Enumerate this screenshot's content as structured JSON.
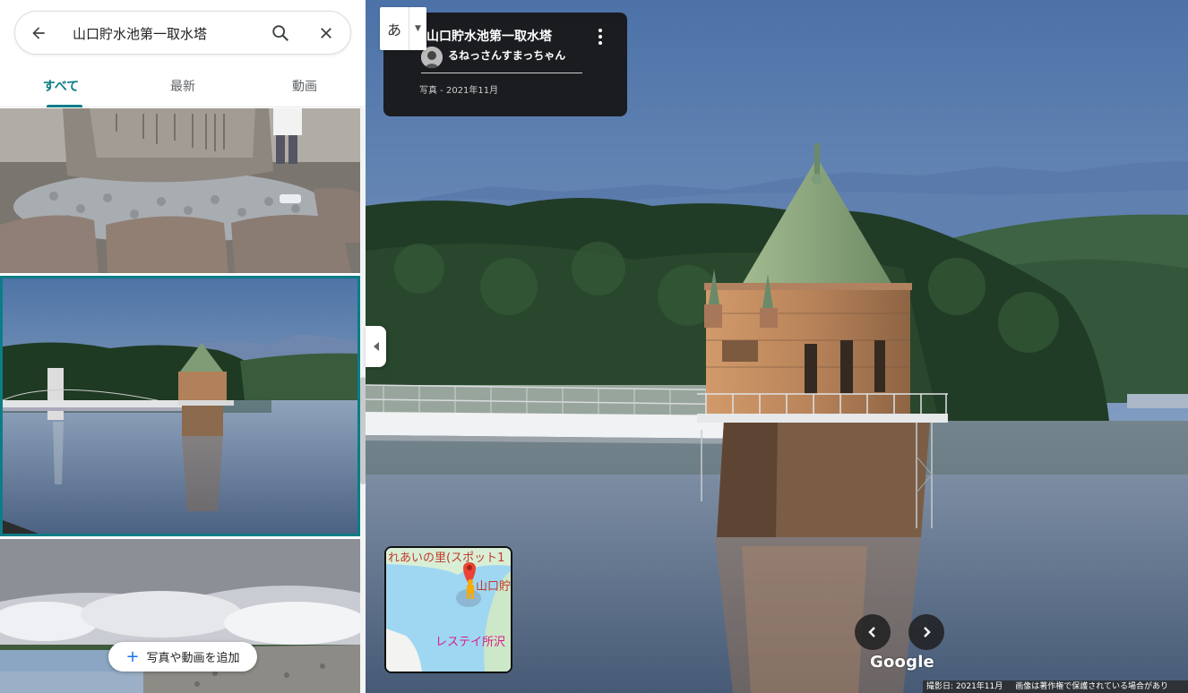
{
  "search": {
    "query": "山口貯水池第一取水塔"
  },
  "tabs": [
    {
      "label": "すべて"
    },
    {
      "label": "最新"
    },
    {
      "label": "動画"
    }
  ],
  "add_button": {
    "label": "写真や動画を追加"
  },
  "photo_info": {
    "title": "山口貯水池第一取水塔",
    "author": "るねっさんすまっちゃん",
    "meta": "写真 - 2021年11月"
  },
  "ime": {
    "char": "あ"
  },
  "minimap": {
    "label_top": "れあいの里(スポット1",
    "label_place": "山口貯",
    "label_bottom": "レステイ所沢"
  },
  "brand": "Google",
  "footer": {
    "date": "撮影日: 2021年11月",
    "copyright": "画像は著作権で保護されている場合があり"
  },
  "colors": {
    "accent": "#0b7d87",
    "add_icon": "#1a73e8",
    "pin": "#ea4335",
    "pegman": "#f9ab00"
  }
}
